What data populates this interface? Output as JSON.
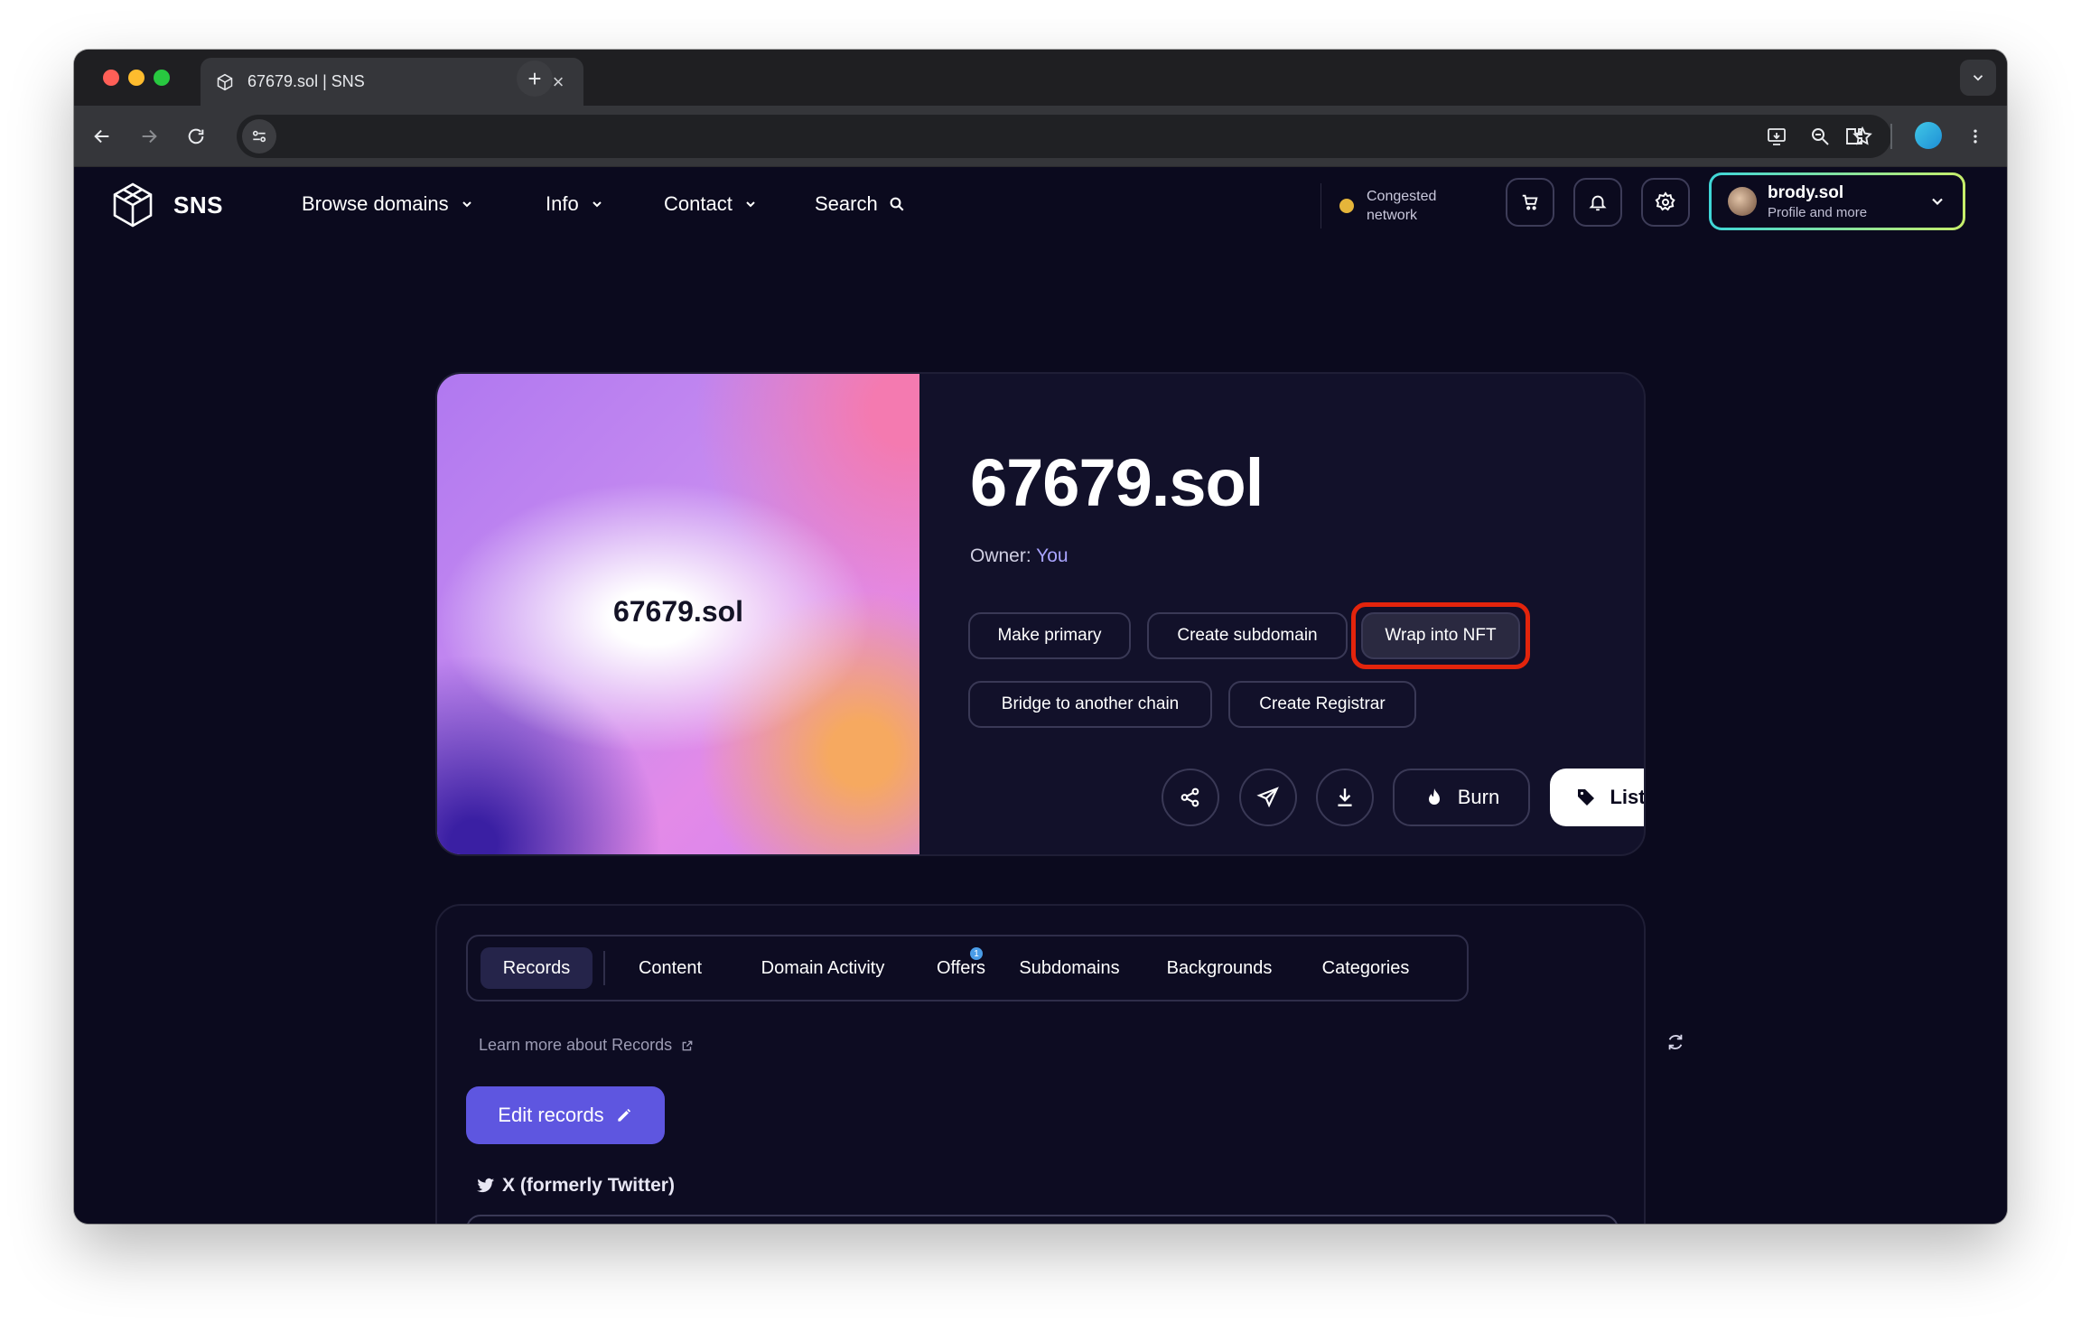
{
  "browser": {
    "tab_title": "67679.sol | SNS",
    "tab_close": "×",
    "new_tab": "+"
  },
  "nav": {
    "brand": "SNS",
    "items": [
      {
        "label": "Browse domains"
      },
      {
        "label": "Info"
      },
      {
        "label": "Contact"
      },
      {
        "label": "Search"
      }
    ],
    "network_status_line1": "Congested",
    "network_status_line2": "network",
    "status_color": "#e5b53a",
    "profile_name": "brody.sol",
    "profile_sub": "Profile and more"
  },
  "domain": {
    "name": "67679.sol",
    "art_label": "67679.sol",
    "owner_label": "Owner: ",
    "owner_value": "You",
    "actions_row1": [
      "Make primary",
      "Create subdomain",
      "Wrap into NFT"
    ],
    "actions_row2": [
      "Bridge to another chain",
      "Create Registrar"
    ],
    "burn_label": "Burn",
    "list_label": "List"
  },
  "records": {
    "tabs": [
      "Records",
      "Content",
      "Domain Activity",
      "Offers",
      "Subdomains",
      "Backgrounds",
      "Categories"
    ],
    "active_tab": "Records",
    "offers_badge": "1",
    "learn_more": "Learn more about Records",
    "edit_label": "Edit records",
    "x_label": "X (formerly Twitter)"
  },
  "colors": {
    "accent": "#5e56e0",
    "highlight_ring": "#e3240c",
    "owner_link": "#a9a4ff"
  }
}
